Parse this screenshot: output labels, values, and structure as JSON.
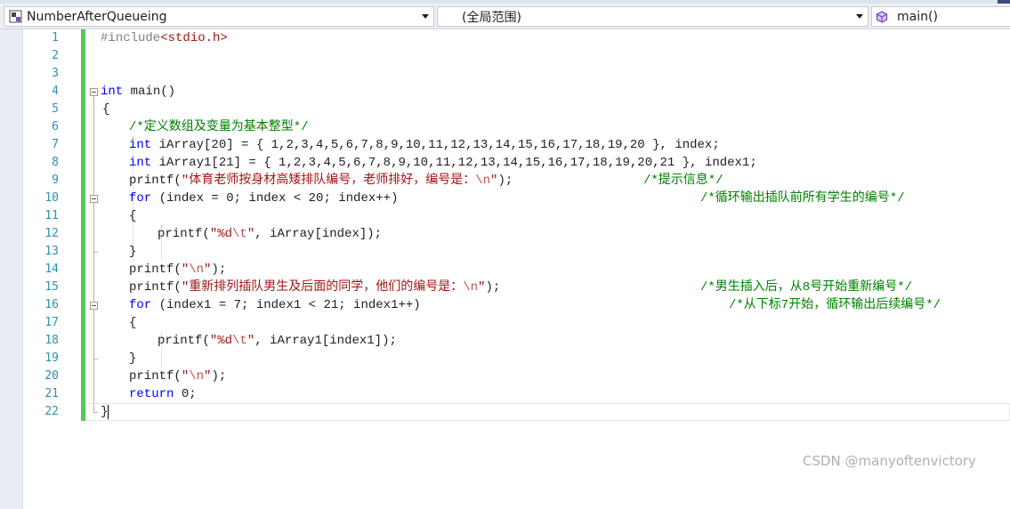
{
  "navbar": {
    "project": "NumberAfterQueueing",
    "scope": "(全局范围)",
    "member": "main()"
  },
  "editor": {
    "line_numbers": [
      "1",
      "2",
      "3",
      "4",
      "5",
      "6",
      "7",
      "8",
      "9",
      "10",
      "11",
      "12",
      "13",
      "14",
      "15",
      "16",
      "17",
      "18",
      "19",
      "20",
      "21",
      "22"
    ],
    "lines": {
      "l1_pp": "#include",
      "l1_inc": "<stdio.h>",
      "l4_kw": "int",
      "l4_rest": " main()",
      "l5": "{",
      "l6_c": "/*定义数组及变量为基本整型*/",
      "l7_kw": "int",
      "l7_rest": " iArray[20] = { 1,2,3,4,5,6,7,8,9,10,11,12,13,14,15,16,17,18,19,20 }, index;",
      "l8_kw": "int",
      "l8_rest": " iArray1[21] = { 1,2,3,4,5,6,7,8,9,10,11,12,13,14,15,16,17,18,19,20,21 }, index1;",
      "l9_fn": "printf(",
      "l9_s": "\"体育老师按身材高矮排队编号，老师排好，编号是：",
      "l9_esc": "\\n",
      "l9_q": "\"",
      "l9_end": ");",
      "l9_c": "/*提示信息*/",
      "l10_kw": "for",
      "l10_rest": " (index = 0; index < 20; index++)",
      "l10_c": "/*循环输出插队前所有学生的编号*/",
      "l11": "{",
      "l12_fn": "printf(",
      "l12_s": "\"%d",
      "l12_esc": "\\t",
      "l12_q": "\"",
      "l12_end": ", iArray[index]);",
      "l13": "}",
      "l14_fn": "printf(",
      "l14_q1": "\"",
      "l14_esc": "\\n",
      "l14_q2": "\"",
      "l14_end": ");",
      "l15_fn": "printf(",
      "l15_s": "\"重新排列插队男生及后面的同学，他们的编号是：",
      "l15_esc": "\\n",
      "l15_q": "\"",
      "l15_end": ");",
      "l15_c": "/*男生插入后，从8号开始重新编号*/",
      "l16_kw": "for",
      "l16_rest": " (index1 = 7; index1 < 21; index1++)",
      "l16_c": "/*从下标7开始，循环输出后续编号*/",
      "l17": "{",
      "l18_fn": "printf(",
      "l18_s": "\"%d",
      "l18_esc": "\\t",
      "l18_q": "\"",
      "l18_end": ", iArray1[index1]);",
      "l19": "}",
      "l20_fn": "printf(",
      "l20_q1": "\"",
      "l20_esc": "\\n",
      "l20_q2": "\"",
      "l20_end": ");",
      "l21_kw": "return",
      "l21_rest": " 0;",
      "l22": "}"
    }
  },
  "watermark": "CSDN @manyoftenvictory",
  "colors": {
    "keyword": "#0000ff",
    "string": "#a31515",
    "comment": "#008000",
    "line_number": "#2b91af",
    "change_bar": "#57c757"
  }
}
